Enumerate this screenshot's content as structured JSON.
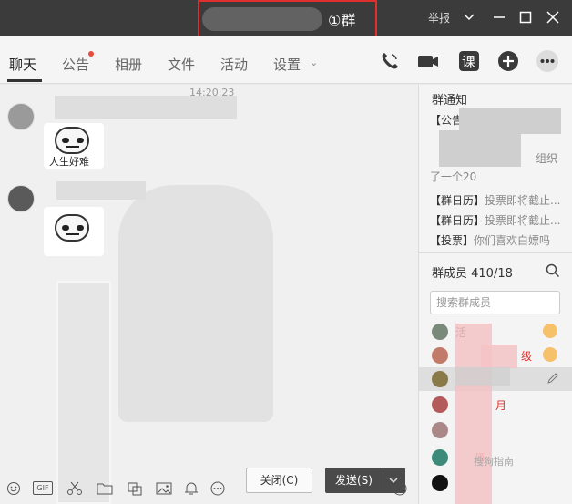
{
  "window": {
    "title_suffix": "①群",
    "report_label": "举报",
    "controls": {
      "dropdown": "chevron-down-icon",
      "minimize": "minimize-icon",
      "maximize": "maximize-icon",
      "close": "close-icon"
    },
    "highlight_color": "#e0302e"
  },
  "tabs": [
    {
      "label": "聊天",
      "active": true
    },
    {
      "label": "公告",
      "has_badge": true
    },
    {
      "label": "相册"
    },
    {
      "label": "文件"
    },
    {
      "label": "活动"
    },
    {
      "label": "设置"
    }
  ],
  "toolbar_icons": [
    "phone-icon",
    "video-icon",
    "homework-icon",
    "add-app-icon",
    "more-icon"
  ],
  "toolbar_homework_label": "课",
  "chat": {
    "timestamp": "14:20:23",
    "messages": [
      {
        "sticker_text": "人生好难"
      },
      {
        "sticker_text": ""
      }
    ],
    "input_tools": [
      "emoji-icon",
      "gif-icon",
      "scissors-icon",
      "folder-icon",
      "screenshot-icon",
      "image-icon",
      "bell-icon",
      "more-icon",
      "history-clock-icon"
    ],
    "gif_label": "GIF",
    "close_button": "关闭(C)",
    "send_button": "发送(S)"
  },
  "right_panel": {
    "notice_title": "群通知",
    "notices": [
      {
        "tag": "【公告",
        "text": ""
      },
      {
        "tag": "",
        "text": "组织"
      },
      {
        "tag": "",
        "text": "了一个20"
      },
      {
        "tag": "【群日历】",
        "text": "投票即将截止..."
      },
      {
        "tag": "【群日历】",
        "text": "投票即将截止..."
      },
      {
        "tag": "【投票】",
        "text": "你们喜欢白嫖吗"
      }
    ],
    "members_title": "群成员 410/18",
    "member_search_placeholder": "搜索群成员",
    "member_fragments": [
      "活",
      "1",
      "级",
      "",
      "月",
      "",
      "师",
      ""
    ]
  },
  "watermark": "搜狗指南"
}
